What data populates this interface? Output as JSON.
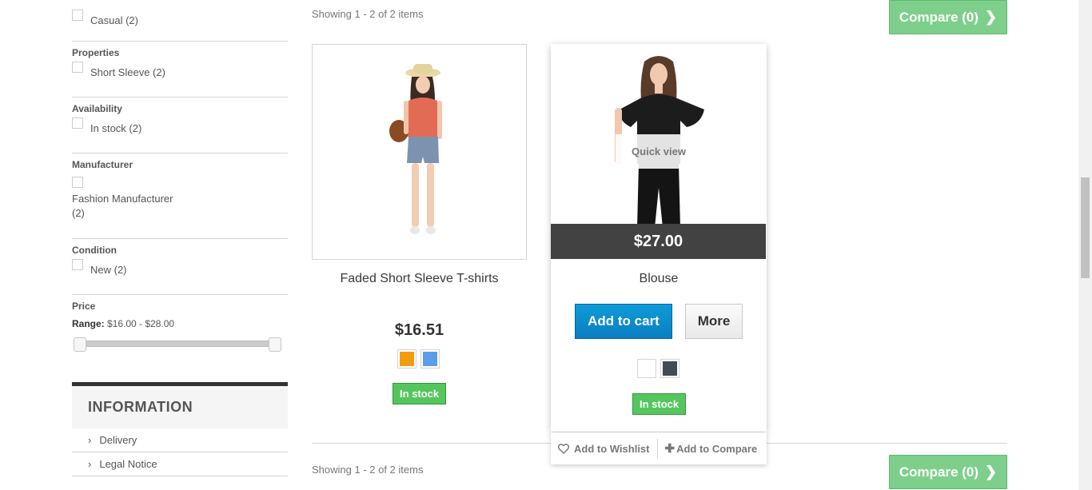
{
  "filters": {
    "styles": {
      "option": "Casual (2)"
    },
    "properties": {
      "title": "Properties",
      "option": "Short Sleeve (2)"
    },
    "availability": {
      "title": "Availability",
      "option": "In stock (2)"
    },
    "manufacturer": {
      "title": "Manufacturer",
      "option_line1": "Fashion Manufacturer",
      "option_line2": "(2)"
    },
    "condition": {
      "title": "Condition",
      "option": "New (2)"
    },
    "price": {
      "title": "Price",
      "range_label": "Range:",
      "range_value": "$16.00 - $28.00",
      "min": 16.0,
      "max": 28.0
    }
  },
  "information": {
    "title": "INFORMATION",
    "items": [
      {
        "label": "Delivery"
      },
      {
        "label": "Legal Notice"
      }
    ]
  },
  "listing": {
    "showing_top": "Showing 1 - 2 of 2 items",
    "showing_bottom": "Showing 1 - 2 of 2 items",
    "compare_label": "Compare (0)"
  },
  "products": [
    {
      "name": "Faded Short Sleeve T-shirts",
      "price": "$16.51",
      "colors": [
        "#f39c11",
        "#5d9cec"
      ],
      "availability": "In stock"
    },
    {
      "name": "Blouse",
      "price": "$27.00",
      "quick_view": "Quick view",
      "add_to_cart": "Add to cart",
      "more": "More",
      "colors": [
        "#ffffff",
        "#434a54"
      ],
      "availability": "In stock",
      "wishlist": "Add to Wishlist",
      "compare": "Add to Compare"
    }
  ],
  "icons": {
    "chevron_right": "chevron-right-icon",
    "heart": "heart-icon",
    "plus": "plus-icon"
  }
}
